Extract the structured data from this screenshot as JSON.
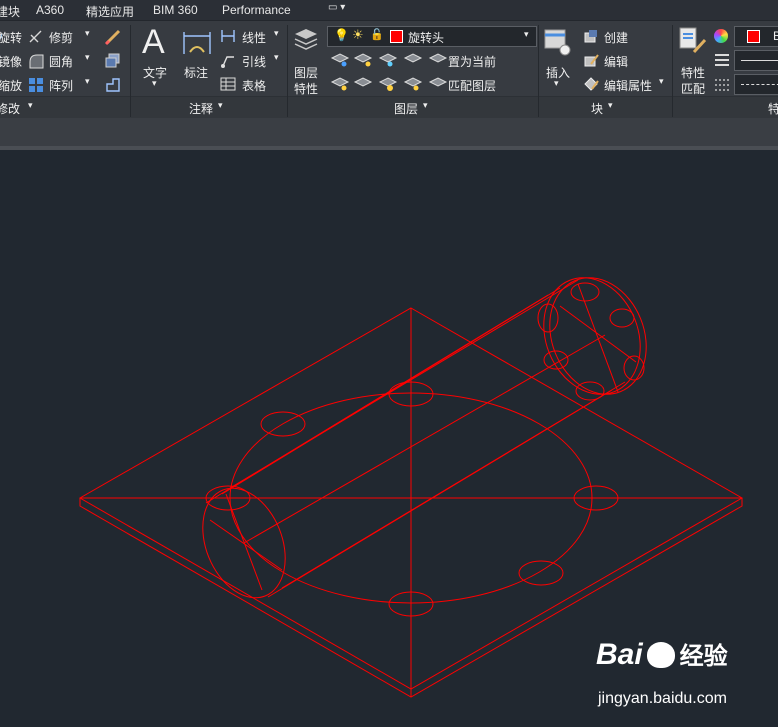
{
  "ribbon_tabs": [
    "建块",
    "A360",
    "精选应用",
    "BIM 360",
    "Performance"
  ],
  "modify": {
    "col1": [
      "旋转",
      "镜像",
      "缩放"
    ],
    "col2": [
      "修剪",
      "圆角",
      "阵列"
    ],
    "title": "修改"
  },
  "annotation": {
    "text": "文字",
    "dimension": "标注",
    "linetype": "线性",
    "leader": "引线",
    "table": "表格",
    "title": "注释"
  },
  "layers": {
    "properties_line1": "图层",
    "properties_line2": "特性",
    "current_layer": "旋转头",
    "set_current": "置为当前",
    "match_layer": "匹配图层",
    "title": "图层"
  },
  "block": {
    "insert": "插入",
    "create": "创建",
    "edit": "编辑",
    "edit_attributes": "编辑属性",
    "title": "块"
  },
  "properties": {
    "match_line1": "特性",
    "match_line2": "匹配",
    "color_label": "B",
    "title": "特"
  },
  "colors": {
    "drawing": "#ff0000",
    "canvas": "#212830",
    "ribbon": "#373b41"
  },
  "watermark": {
    "brand": "Bai",
    "brand2": "经验",
    "url": "jingyan.baidu.com"
  }
}
